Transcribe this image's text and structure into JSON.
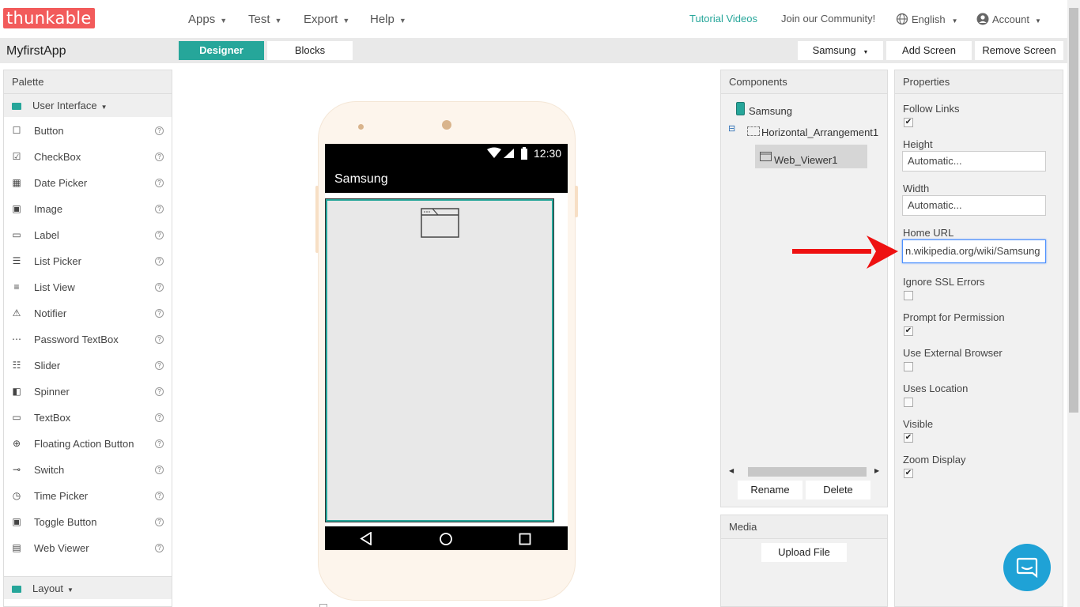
{
  "header": {
    "logo": "thunkable",
    "menus": [
      "Apps",
      "Test",
      "Export",
      "Help"
    ],
    "tutorial": "Tutorial Videos",
    "community": "Join our Community!",
    "language": "English",
    "account": "Account"
  },
  "toolbar": {
    "app_name": "MyfirstApp",
    "designer": "Designer",
    "blocks": "Blocks",
    "screen_select": "Samsung",
    "add_screen": "Add Screen",
    "remove_screen": "Remove Screen"
  },
  "palette": {
    "title": "Palette",
    "folder_ui": "User Interface",
    "folder_layout": "Layout",
    "items": [
      "Button",
      "CheckBox",
      "Date Picker",
      "Image",
      "Label",
      "List Picker",
      "List View",
      "Notifier",
      "Password TextBox",
      "Slider",
      "Spinner",
      "TextBox",
      "Floating Action Button",
      "Switch",
      "Time Picker",
      "Toggle Button",
      "Web Viewer"
    ],
    "help_glyph": "?"
  },
  "phone": {
    "time": "12:30",
    "title": "Samsung"
  },
  "components": {
    "title": "Components",
    "tree": [
      "Samsung",
      "Horizontal_Arrangement1",
      "Web_Viewer1"
    ],
    "collapse_glyph": "⊟",
    "rename": "Rename",
    "delete": "Delete"
  },
  "media": {
    "title": "Media",
    "upload": "Upload File"
  },
  "properties": {
    "title": "Properties",
    "follow_links": "Follow Links",
    "height": "Height",
    "height_value": "Automatic...",
    "width": "Width",
    "width_value": "Automatic...",
    "home_url": "Home URL",
    "home_url_value": "n.wikipedia.org/wiki/Samsung",
    "ignore_ssl": "Ignore SSL Errors",
    "prompt_permission": "Prompt for Permission",
    "external_browser": "Use External Browser",
    "uses_location": "Uses Location",
    "visible": "Visible",
    "zoom_display": "Zoom Display",
    "checked": {
      "follow_links": true,
      "ignore_ssl": false,
      "prompt_permission": true,
      "external_browser": false,
      "uses_location": false,
      "visible": true,
      "zoom_display": true
    }
  },
  "colors": {
    "brand": "#f25b5b",
    "accent": "#26a69a",
    "arrow": "#ee1111",
    "chat": "#1fa2d6"
  }
}
